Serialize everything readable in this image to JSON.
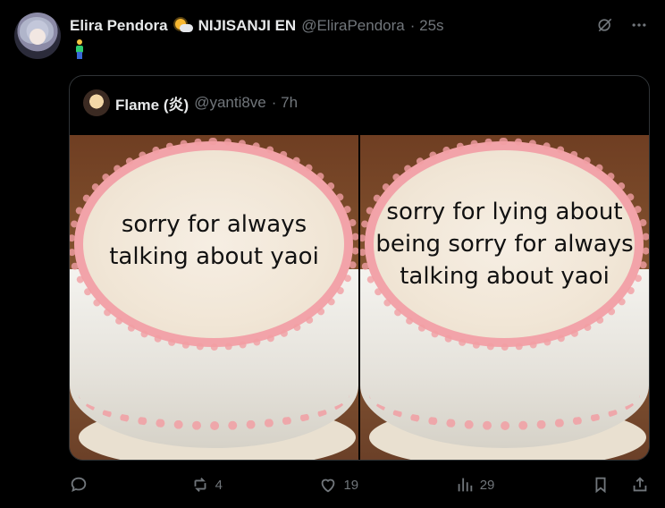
{
  "post": {
    "author_name": "Elira Pendora",
    "org": "NIJISANJI EN",
    "handle": "@EliraPendora",
    "time": "· 25s"
  },
  "quote": {
    "author_name": "Flame (炎)",
    "handle": "@yanti8ve",
    "time": "· 7h",
    "images": [
      {
        "caption_lines": [
          "sorry for always",
          "talking about yaoi"
        ]
      },
      {
        "caption_lines": [
          "sorry for lying about",
          "being sorry for always",
          "talking about yaoi"
        ]
      }
    ]
  },
  "actions": {
    "replies": "",
    "reposts": "4",
    "likes": "19",
    "views": "29"
  },
  "colors": {
    "background": "#000000",
    "text": "#e7e9ea",
    "muted": "#71767b",
    "border": "#2f3336",
    "frosting": "#f2a3a9"
  },
  "icons": {
    "weather": "sun-behind-cloud-icon",
    "person": "person-standing-emoji",
    "top_right": [
      "grok-icon",
      "more-icon"
    ],
    "actions": [
      "reply-icon",
      "repost-icon",
      "like-icon",
      "views-icon",
      "bookmark-icon",
      "share-icon"
    ]
  }
}
